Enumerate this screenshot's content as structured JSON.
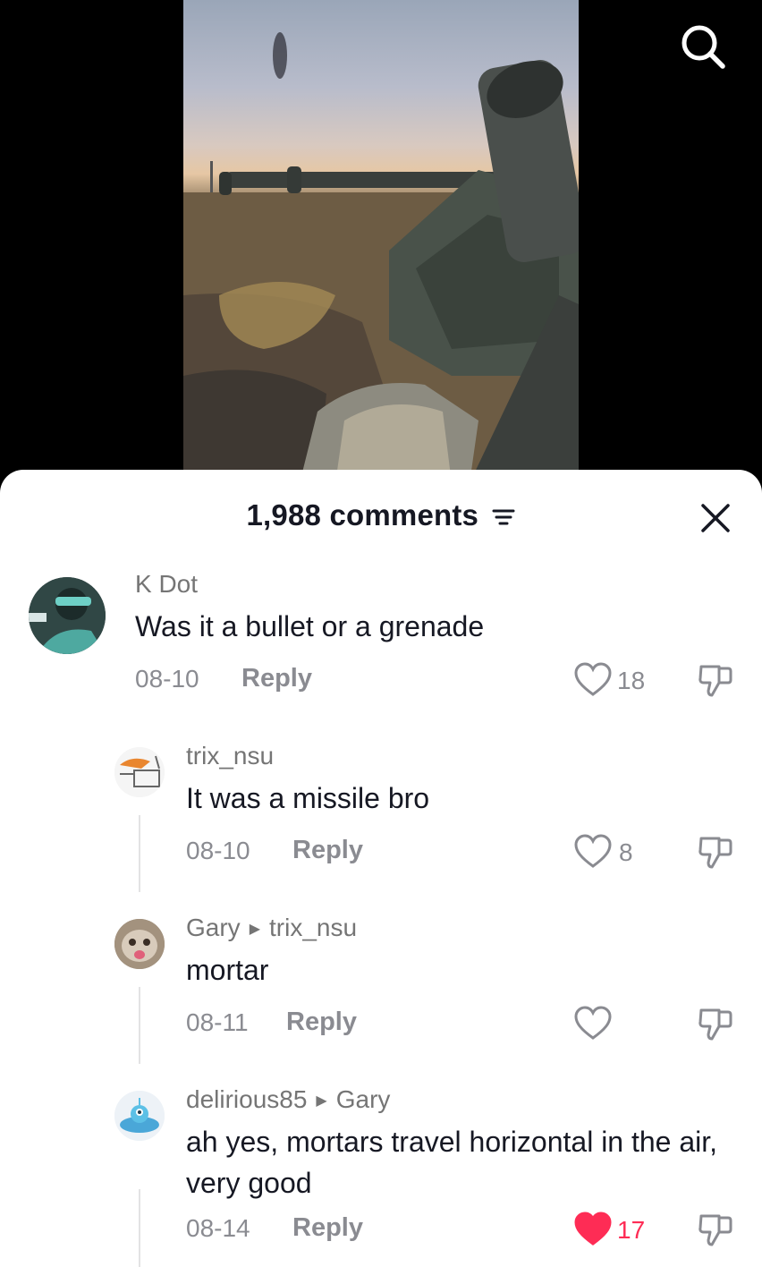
{
  "header": {
    "comment_count": "1,988 comments"
  },
  "comments": [
    {
      "username": "K Dot",
      "text": "Was it a bullet or a grenade",
      "date": "08-10",
      "reply_label": "Reply",
      "likes": "18",
      "liked": false
    },
    {
      "username": "trix_nsu",
      "text": "It was a missile bro",
      "date": "08-10",
      "reply_label": "Reply",
      "likes": "8",
      "liked": false
    },
    {
      "username": "Gary",
      "reply_to": "trix_nsu",
      "text": "mortar",
      "date": "08-11",
      "reply_label": "Reply",
      "likes": "",
      "liked": false
    },
    {
      "username": "delirious85",
      "reply_to": "Gary",
      "text": "ah yes, mortars travel horizontal in the air, very good",
      "date": "08-14",
      "reply_label": "Reply",
      "likes": "17",
      "liked": true
    }
  ],
  "colors": {
    "primary_text": "#161823",
    "secondary_text": "#8a8b91",
    "liked_heart": "#fe2c55",
    "sheet_background": "#ffffff",
    "video_background": "#000000"
  },
  "icons": {
    "search": "search-icon",
    "sort": "sort-icon",
    "close": "close-icon",
    "like": "heart-icon",
    "dislike": "thumbs-down-icon"
  }
}
